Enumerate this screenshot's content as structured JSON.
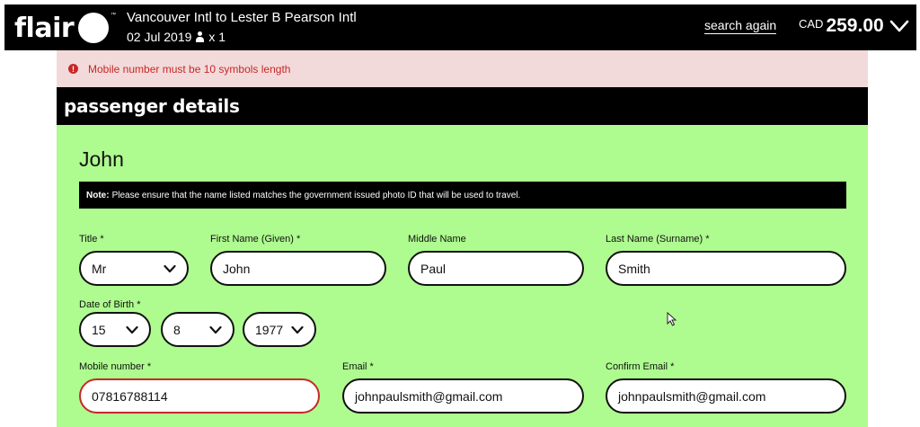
{
  "header": {
    "logo_text": "flair",
    "logo_tm": "™",
    "route_title": "Vancouver Intl to Lester B Pearson Intl",
    "date": "02 Jul 2019",
    "passenger_count": "x 1",
    "search_again": "search again",
    "currency": "CAD",
    "price": "259.00"
  },
  "error": {
    "icon": "!",
    "message": "Mobile number must be 10 symbols length"
  },
  "section": {
    "title": "passenger details"
  },
  "passenger": {
    "name": "John",
    "note_label": "Note:",
    "note_text": "Please ensure that the name listed matches the government issued photo ID that will be used to travel."
  },
  "form": {
    "title_label": "Title *",
    "title_value": "Mr",
    "first_name_label": "First Name (Given) *",
    "first_name_value": "John",
    "middle_name_label": "Middle Name",
    "middle_name_value": "Paul",
    "last_name_label": "Last Name (Surname) *",
    "last_name_value": "Smith",
    "dob_label": "Date of Birth *",
    "dob_day": "15",
    "dob_month": "8",
    "dob_year": "1977",
    "mobile_label": "Mobile number *",
    "mobile_value": "07816788114",
    "email_label": "Email *",
    "email_value": "johnpaulsmith@gmail.com",
    "confirm_email_label": "Confirm Email *",
    "confirm_email_value": "johnpaulsmith@gmail.com"
  },
  "colors": {
    "header_bg": "#000000",
    "form_bg": "#aefb8f",
    "error_bg": "#f3dada",
    "error_text": "#c62828"
  },
  "icons": [
    "user-icon",
    "chevron-down-icon",
    "error-icon",
    "cursor-icon"
  ]
}
